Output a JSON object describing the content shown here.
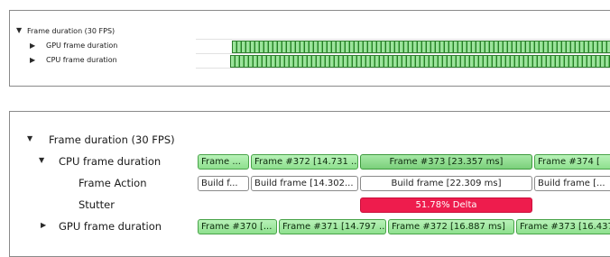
{
  "top_panel": {
    "root": "Frame duration (30 FPS)",
    "rows": [
      "GPU frame duration",
      "CPU frame duration"
    ]
  },
  "bottom_panel": {
    "root": "Frame duration (30 FPS)",
    "cpu_label": "CPU frame duration",
    "frame_action_label": "Frame Action",
    "stutter_label": "Stutter",
    "gpu_label": "GPU frame duration",
    "cpu_frames": [
      "Frame ...",
      "Frame #372 [14.731 ...",
      "Frame #373 [23.357 ms]",
      "Frame #374 ["
    ],
    "frame_actions": [
      "Build f...",
      "Build frame [14.302...",
      "Build frame [22.309 ms]",
      "Build frame [..."
    ],
    "stutter": "51.78% Delta",
    "gpu_frames": [
      "Frame #370 [...",
      "Frame #371 [14.797 ...",
      "Frame #372 [16.887 ms]",
      "Frame #373 [16.437"
    ]
  },
  "colors": {
    "frame_green": "#8ee08e",
    "stutter_red": "#ee1c4d",
    "frame_action_white": "#ffffff"
  },
  "icons": {
    "expanded": "triangle-down-icon",
    "collapsed": "triangle-right-icon"
  }
}
